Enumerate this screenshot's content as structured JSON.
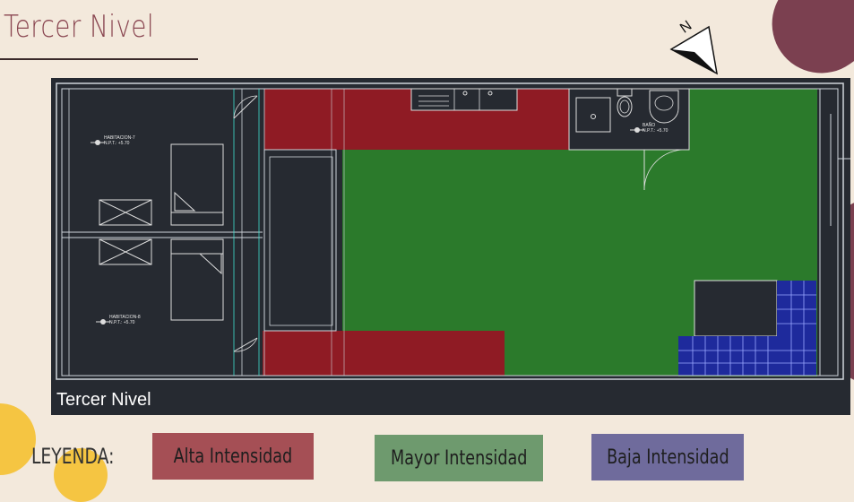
{
  "header": {
    "title": "Tercer Nivel"
  },
  "plan": {
    "caption": "Tercer Nivel",
    "rooms": [
      {
        "name": "HABITACION-7",
        "level": "N.P.T.: +5.70"
      },
      {
        "name": "HABITACION-8",
        "level": "N.P.T.: +5.70"
      },
      {
        "name": "BAÑO",
        "level": "N.P.T.: +5.70"
      }
    ],
    "compass_label": "N"
  },
  "legend": {
    "title": "LEYENDA:",
    "items": [
      {
        "label": "Alta Intensidad",
        "color": "#a54f55"
      },
      {
        "label": "Mayor Intensidad",
        "color": "#6e9a6e"
      },
      {
        "label": "Baja Intensidad",
        "color": "#6f6b9c"
      }
    ]
  },
  "colors": {
    "high": "#8f1b24",
    "medium": "#2b7a2b",
    "low": "#1e2a9c",
    "background": "#f3e9dc",
    "accent": "#7b4050"
  }
}
